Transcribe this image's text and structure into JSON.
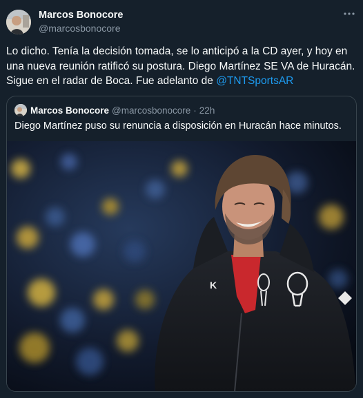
{
  "tweet": {
    "author_name": "Marcos Bonocore",
    "author_handle": "@marcosbonocore",
    "text_before_mention": "Lo dicho. Tenía la decisión tomada, se lo anticipó a la CD ayer, y hoy en una nueva reunión ratificó su postura. Diego Martínez SE VA de Huracán. Sigue en el radar de Boca. Fue adelanto de ",
    "mention": "@TNTSportsAR",
    "more_icon": "more-icon"
  },
  "quoted": {
    "author_name": "Marcos Bonocore",
    "author_handle": "@marcosbonocore",
    "separator": "·",
    "time": "22h",
    "text": "Diego Martínez puso su renuncia a disposición en Huracán hace minutos."
  },
  "colors": {
    "background": "#15202b",
    "text": "#f7f9f9",
    "secondary": "#8b98a5",
    "accent": "#1d9bf0",
    "border": "#38444d"
  }
}
